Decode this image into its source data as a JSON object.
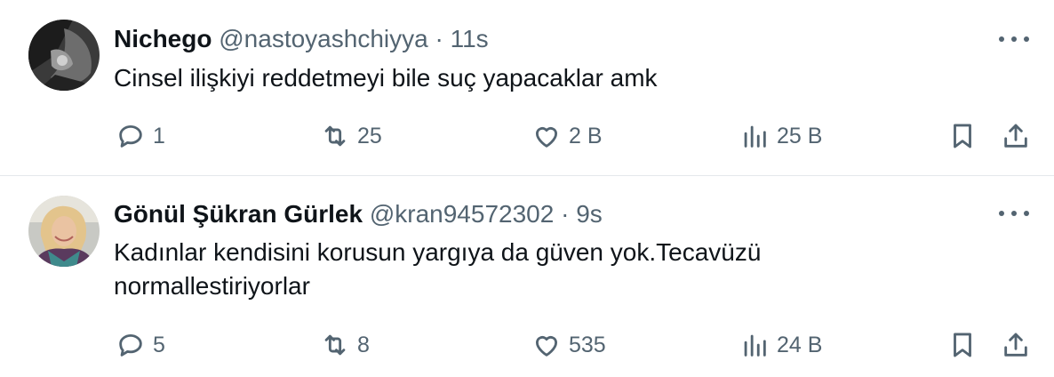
{
  "tweets": [
    {
      "name": "Nichego",
      "handle": "@nastoyashchiyya",
      "separator": "·",
      "time": "11s",
      "text": "Cinsel ilişkiyi reddetmeyi bile suç yapacaklar amk",
      "replies": "1",
      "retweets": "25",
      "likes": "2 B",
      "views": "25 B"
    },
    {
      "name": "Gönül Şükran Gürlek",
      "handle": "@kran94572302",
      "separator": "·",
      "time": "9s",
      "text": "Kadınlar kendisini korusun yargıya da güven yok.Tecavüzü normallestiriyorlar",
      "replies": "5",
      "retweets": "8",
      "likes": "535",
      "views": "24 B"
    }
  ],
  "icons": {
    "reply": "reply-icon",
    "retweet": "retweet-icon",
    "like": "heart-icon",
    "views": "views-icon",
    "bookmark": "bookmark-icon",
    "share": "share-icon",
    "more": "more-icon"
  },
  "colors": {
    "text": "#0f1419",
    "secondary": "#536471",
    "divider": "#e5e8eb"
  }
}
